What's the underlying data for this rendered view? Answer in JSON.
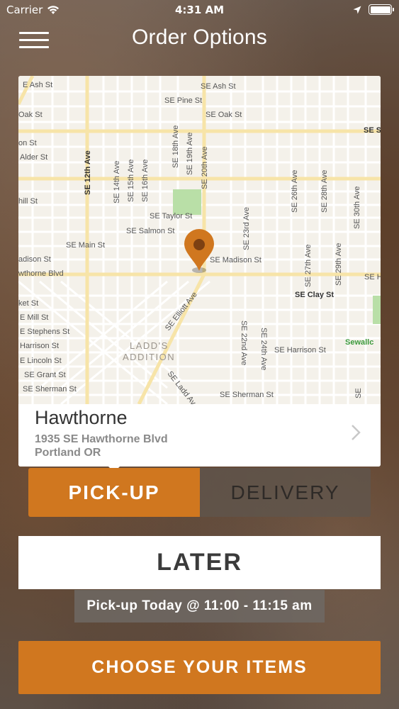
{
  "status_bar": {
    "carrier": "Carrier",
    "time": "4:31 AM"
  },
  "nav": {
    "title": "Order Options"
  },
  "map": {
    "streets": {
      "ash_left": "E Ash St",
      "ash": "SE Ash St",
      "pine": "SE Pine St",
      "oak_left": "Oak St",
      "oak": "SE Oak St",
      "stark_edge": "SE S",
      "n_st": "on St",
      "alder": "Alder St",
      "twelfth": "SE 12th Ave",
      "fourteenth": "SE 14th Ave",
      "fifteenth": "SE 15th Ave",
      "sixteenth": "SE 16th Ave",
      "eighteenth": "SE 18th Ave",
      "nineteenth": "SE 19th Ave",
      "twentieth": "SE 20th Ave",
      "twentysixth": "SE 26th Ave",
      "twentyeighth": "SE 28th Ave",
      "thirtieth": "SE 30th Ave",
      "hill": "hill St",
      "taylor": "SE Taylor St",
      "salmon": "SE Salmon St",
      "twentythird": "SE 23rd Ave",
      "main": "SE Main St",
      "madison_left": "adison St",
      "madison": "SE Madison St",
      "twentyseventh": "SE 27th Ave",
      "twentyninth": "SE 29th Ave",
      "hawthorne_left": "wthorne Blvd",
      "hawthorne_right": "SE H",
      "clay": "SE Clay St",
      "elliott": "SE Elliott Ave",
      "market": "ket St",
      "mill": "E Mill St",
      "stephens": "E Stephens St",
      "harrison_left": "Harrison St",
      "harrison": "SE Harrison St",
      "lincoln": "E Lincoln St",
      "grant": "SE Grant St",
      "sherman_left": "SE Sherman St",
      "sherman": "SE Sherman St",
      "ladd_ave": "SE Ladd Ave",
      "twentysecond": "SE 22nd Ave",
      "twentyfourth": "SE 24th Ave",
      "ladds_1": "LADD'S",
      "ladds_2": "ADDITION",
      "sewallcrest": "Sewallc",
      "se_edge": "SE"
    },
    "pin_icon": "map-pin-icon",
    "pin_color": "#d0771f"
  },
  "location": {
    "name": "Hawthorne",
    "address": "1935 SE Hawthorne Blvd",
    "city": "Portland OR",
    "chevron_icon": "chevron-right-icon"
  },
  "order_type": {
    "pickup_label": "PICK-UP",
    "delivery_label": "DELIVERY",
    "selected": "PICK-UP"
  },
  "timing": {
    "later_label": "LATER",
    "pickup_time": "Pick-up Today @ 11:00 - 11:15 am"
  },
  "cta": {
    "label": "CHOOSE YOUR ITEMS"
  },
  "colors": {
    "accent": "#d0771f",
    "delivery_bg": "#5f554e",
    "text_dark": "#333333",
    "text_muted": "#8a8a8a"
  }
}
